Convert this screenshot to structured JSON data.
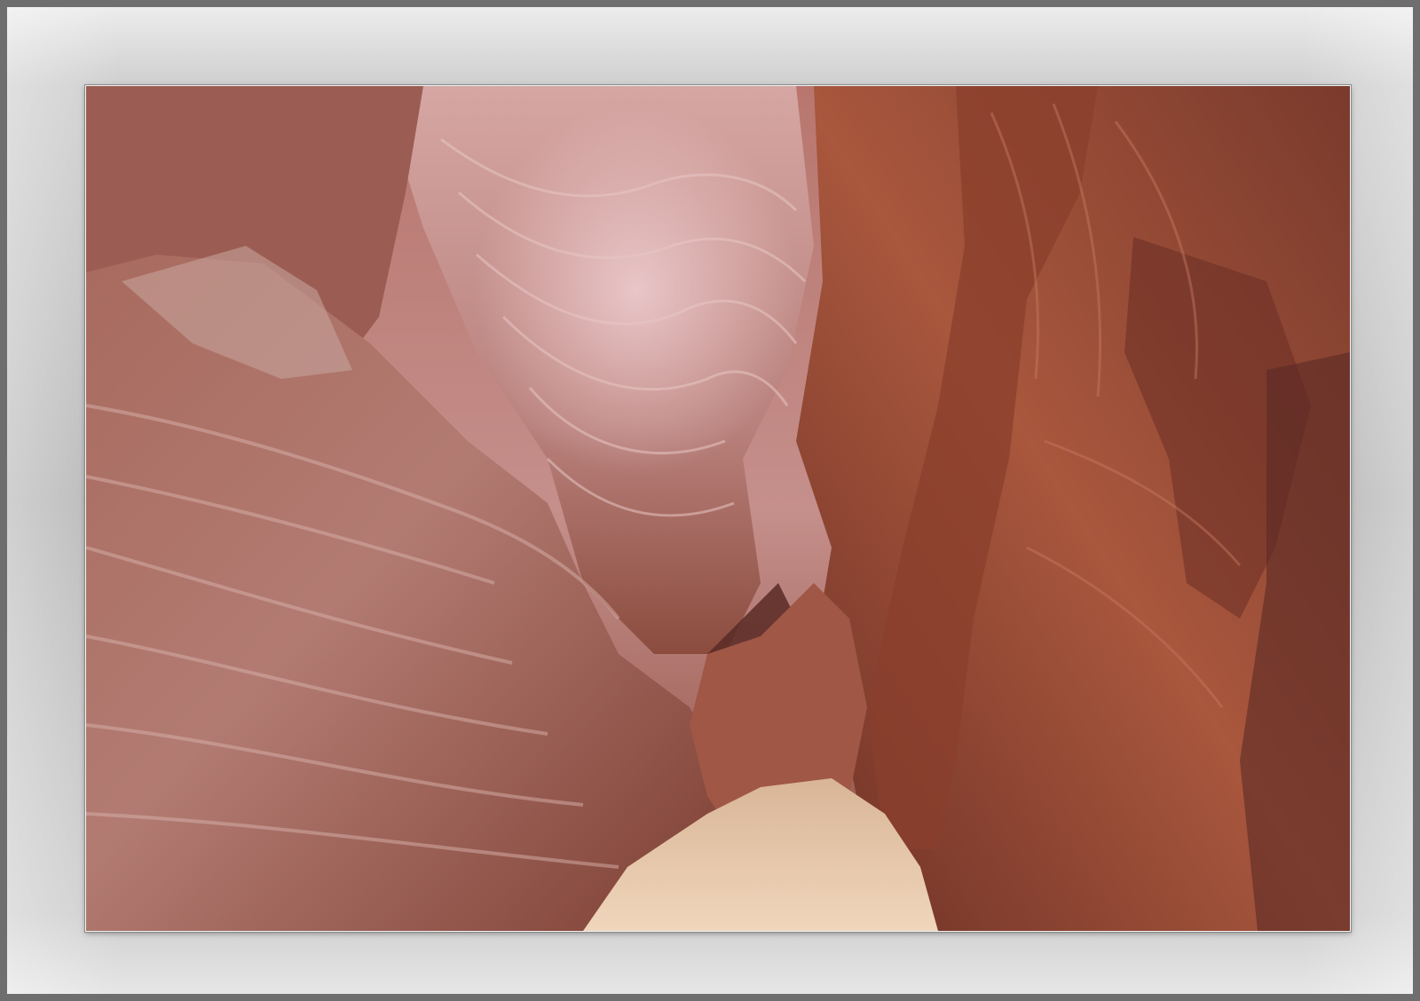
{
  "image": {
    "subject": "slot-canyon-sandstone",
    "colors": {
      "frame_border": "#6e6e6e",
      "mat_light": "#ececec",
      "mat_dark": "#b7b7b7",
      "rock_red": "#9a4a38",
      "rock_pink": "#c98a86",
      "rock_shadow": "#4a2522",
      "sand": "#e8c9a8",
      "sky": "#eaf4ff"
    }
  }
}
